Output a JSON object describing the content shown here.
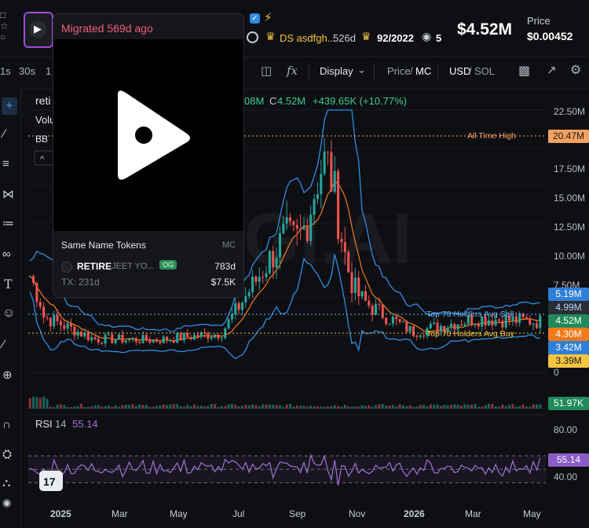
{
  "header": {
    "token_stats": {
      "holders": "526d",
      "top_ratio": "92/2022",
      "watchers": "5"
    },
    "dev_label": "DS asdfgh...",
    "market_cap": "$4.52M",
    "price_label": "Price",
    "price": "$0.00452"
  },
  "toolbar": {
    "intervals": [
      "1s",
      "30s",
      "1"
    ],
    "display": "Display",
    "price_mc": {
      "price": "Price",
      "sep": "/",
      "mc": "MC"
    },
    "currency": {
      "usd": "USD",
      "sep": "/",
      "sol": "SOL"
    }
  },
  "legend": {
    "symbol": "reti",
    "volume": "Volu",
    "bb": "BB",
    "ohlc_tail": "08M",
    "close_label": "C",
    "close_value": "4.52M",
    "change": "+439.65K (+10.77%)"
  },
  "watermark": "GI.AI",
  "popup": {
    "status": "Migrated 569d ago",
    "same_name_title": "Same Name Tokens",
    "same_name_col": "MC",
    "token": {
      "name": "RETIRE",
      "desc": "JEET YO...",
      "tag": "OG",
      "age": "783d",
      "tx": "TX: 231d",
      "mc": "$7.5K"
    }
  },
  "annotations": {
    "ath": "All Time High",
    "top70_sell": "Top 70 Holders Avg Sell",
    "top70_buy": "Top 70 Holders Avg Buy"
  },
  "price_axis": [
    "22.50M",
    "17.50M",
    "15.00M",
    "12.50M",
    "10.00M",
    "7.50M",
    "0"
  ],
  "badges": [
    {
      "label": "20.47M",
      "bg": "#f4a261",
      "fg": "#1a1a1a"
    },
    {
      "label": "5.19M",
      "bg": "#2f7fd9",
      "fg": "#ffffff"
    },
    {
      "label": "4.99M",
      "bg": "#2a2d36",
      "fg": "#b9d4f5"
    },
    {
      "label": "4.52M",
      "bg": "#1f8a5b",
      "fg": "#ffffff"
    },
    {
      "label": "4.30M",
      "bg": "#f27a1a",
      "fg": "#ffffff"
    },
    {
      "label": "3.42M",
      "bg": "#2f7fd9",
      "fg": "#ffffff"
    },
    {
      "label": "3.39M",
      "bg": "#f5c542",
      "fg": "#1a1a1a"
    },
    {
      "label": "51.97K",
      "bg": "#1f8a5b",
      "fg": "#ffffff"
    },
    {
      "label": "55.14",
      "bg": "#8a5cc7",
      "fg": "#ffffff"
    }
  ],
  "rsi": {
    "label": "RSI",
    "period": "14",
    "value": "55.14",
    "axis": [
      "80.00",
      "40.00"
    ]
  },
  "time_axis": [
    "2025",
    "Mar",
    "May",
    "Jul",
    "Sep",
    "Nov",
    "2026",
    "Mar",
    "May"
  ],
  "colors": {
    "up": "#26a69a",
    "down": "#ef5350",
    "bb": "#2f8de4",
    "ma": "#f27a1a",
    "rsi": "#a072d6"
  },
  "chart_data": {
    "type": "candlestick",
    "x": [
      "2025",
      "Mar",
      "May",
      "Jul",
      "Sep",
      "Nov",
      "2026",
      "Mar",
      "May"
    ],
    "close_approx_M": [
      5.5,
      3.0,
      2.9,
      3.5,
      12.0,
      7.0,
      3.6,
      4.8,
      4.52
    ],
    "ylim_M": [
      0,
      23
    ],
    "ath_M": 20.47,
    "rsi_ylim": [
      20,
      90
    ]
  }
}
